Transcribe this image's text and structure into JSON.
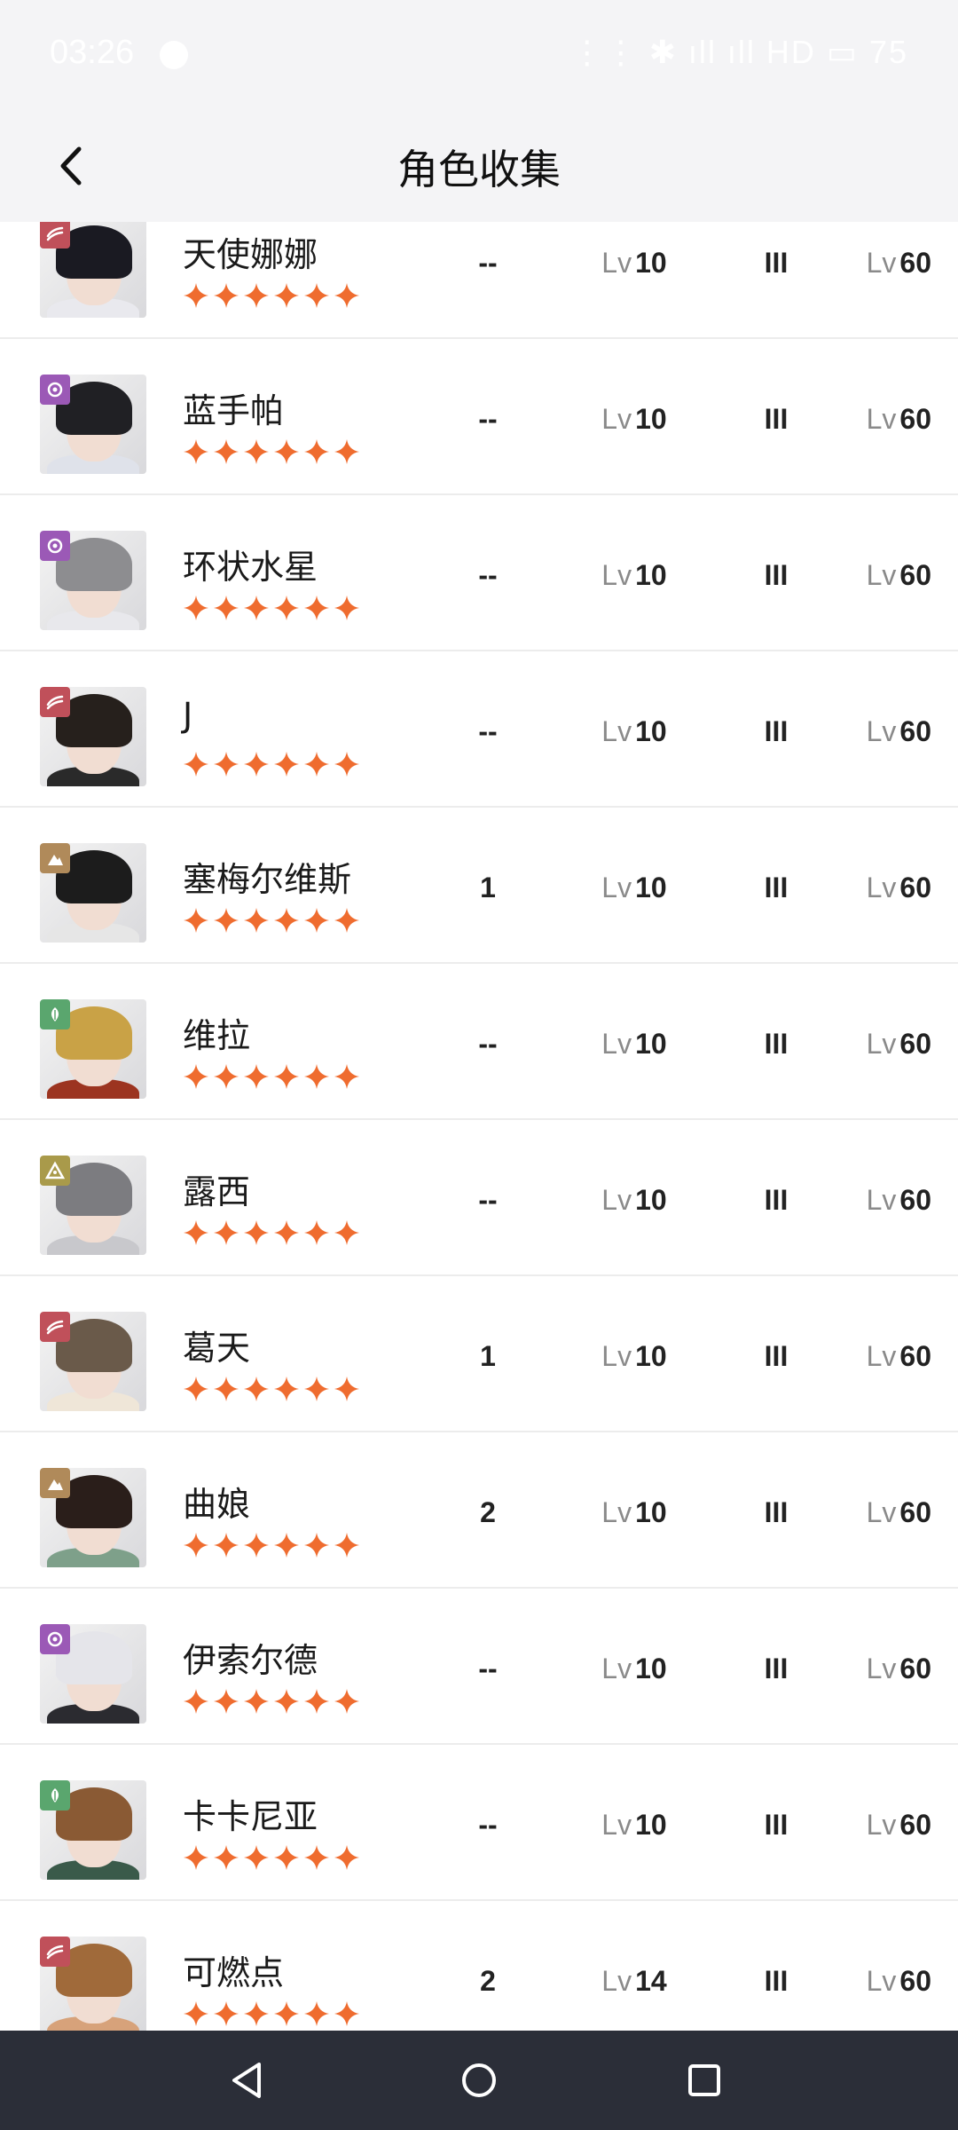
{
  "status": {
    "time": "03:26",
    "right": "⋮⋮ ✱ ıll ıll HD ▭ 75"
  },
  "header": {
    "title": "角色收集"
  },
  "colors": {
    "star": "#ef6c2f",
    "navbar": "#2b2e38",
    "header_bg": "#f4f4f6"
  },
  "rows": [
    {
      "name": "天使娜娜",
      "badge": "wave",
      "badge_color": "#c0505a",
      "stars": 6,
      "col1": "--",
      "lv_label": "Lv",
      "lv": "10",
      "rank": "III",
      "lv2_label": "Lv",
      "lv2": "60",
      "hair": "#1a1a22",
      "cloth": "#e9e9ee"
    },
    {
      "name": "蓝手帕",
      "badge": "spiral",
      "badge_color": "#9b59b6",
      "stars": 6,
      "col1": "--",
      "lv_label": "Lv",
      "lv": "10",
      "rank": "III",
      "lv2_label": "Lv",
      "lv2": "60",
      "hair": "#202024",
      "cloth": "#dfe2ea"
    },
    {
      "name": "环状水星",
      "badge": "spiral",
      "badge_color": "#9b59b6",
      "stars": 6,
      "col1": "--",
      "lv_label": "Lv",
      "lv": "10",
      "rank": "III",
      "lv2_label": "Lv",
      "lv2": "60",
      "hair": "#8d8d90",
      "cloth": "#e8e8ec"
    },
    {
      "name": "J",
      "badge": "wave",
      "badge_color": "#c0505a",
      "stars": 6,
      "col1": "--",
      "lv_label": "Lv",
      "lv": "10",
      "rank": "III",
      "lv2_label": "Lv",
      "lv2": "60",
      "hair": "#26201c",
      "cloth": "#2a2a2a"
    },
    {
      "name": "塞梅尔维斯",
      "badge": "mountain",
      "badge_color": "#b08a5a",
      "stars": 6,
      "col1": "1",
      "lv_label": "Lv",
      "lv": "10",
      "rank": "III",
      "lv2_label": "Lv",
      "lv2": "60",
      "hair": "#1c1c1c",
      "cloth": "#e6e6e6"
    },
    {
      "name": "维拉",
      "badge": "leaf",
      "badge_color": "#5aa66e",
      "stars": 6,
      "col1": "--",
      "lv_label": "Lv",
      "lv": "10",
      "rank": "III",
      "lv2_label": "Lv",
      "lv2": "60",
      "hair": "#c9a246",
      "cloth": "#9c3420"
    },
    {
      "name": "露西",
      "badge": "pyramid",
      "badge_color": "#a99a4a",
      "stars": 6,
      "col1": "--",
      "lv_label": "Lv",
      "lv": "10",
      "rank": "III",
      "lv2_label": "Lv",
      "lv2": "60",
      "hair": "#7c7c80",
      "cloth": "#c8c8cc"
    },
    {
      "name": "葛天",
      "badge": "wave",
      "badge_color": "#c0505a",
      "stars": 6,
      "col1": "1",
      "lv_label": "Lv",
      "lv": "10",
      "rank": "III",
      "lv2_label": "Lv",
      "lv2": "60",
      "hair": "#6a5a4a",
      "cloth": "#efe6d8"
    },
    {
      "name": "曲娘",
      "badge": "mountain",
      "badge_color": "#b08a5a",
      "stars": 6,
      "col1": "2",
      "lv_label": "Lv",
      "lv": "10",
      "rank": "III",
      "lv2_label": "Lv",
      "lv2": "60",
      "hair": "#2a1e1a",
      "cloth": "#7ea08a"
    },
    {
      "name": "伊索尔德",
      "badge": "spiral",
      "badge_color": "#9b59b6",
      "stars": 6,
      "col1": "--",
      "lv_label": "Lv",
      "lv": "10",
      "rank": "III",
      "lv2_label": "Lv",
      "lv2": "60",
      "hair": "#e5e5ea",
      "cloth": "#2b2b30"
    },
    {
      "name": "卡卡尼亚",
      "badge": "leaf",
      "badge_color": "#5aa66e",
      "stars": 6,
      "col1": "--",
      "lv_label": "Lv",
      "lv": "10",
      "rank": "III",
      "lv2_label": "Lv",
      "lv2": "60",
      "hair": "#8a5a34",
      "cloth": "#3a5a4a"
    },
    {
      "name": "可燃点",
      "badge": "wave",
      "badge_color": "#c0505a",
      "stars": 6,
      "col1": "2",
      "lv_label": "Lv",
      "lv": "14",
      "rank": "III",
      "lv2_label": "Lv",
      "lv2": "60",
      "hair": "#a06a3a",
      "cloth": "#d7a27a"
    }
  ]
}
